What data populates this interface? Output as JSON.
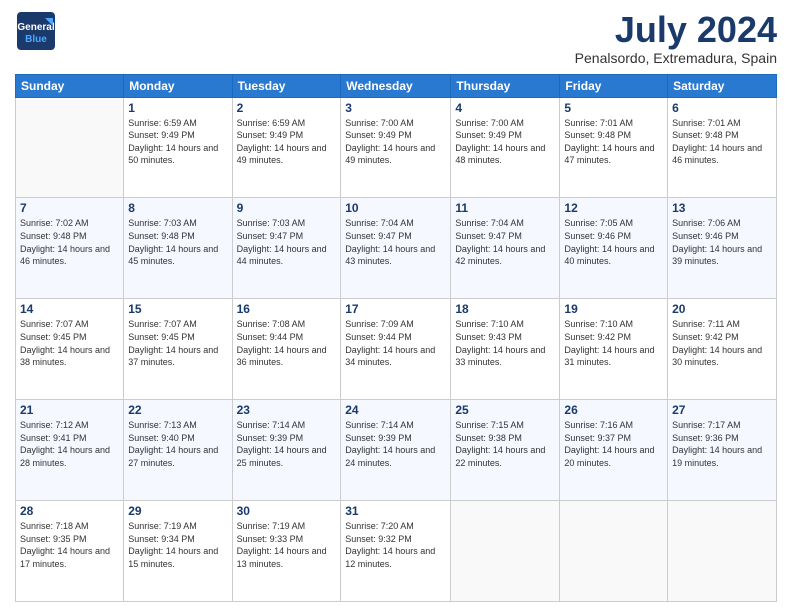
{
  "logo": {
    "line1": "General",
    "line2": "Blue"
  },
  "title": "July 2024",
  "location": "Penalsordo, Extremadura, Spain",
  "weekdays": [
    "Sunday",
    "Monday",
    "Tuesday",
    "Wednesday",
    "Thursday",
    "Friday",
    "Saturday"
  ],
  "weeks": [
    [
      {
        "day": "",
        "sunrise": "",
        "sunset": "",
        "daylight": ""
      },
      {
        "day": "1",
        "sunrise": "Sunrise: 6:59 AM",
        "sunset": "Sunset: 9:49 PM",
        "daylight": "Daylight: 14 hours and 50 minutes."
      },
      {
        "day": "2",
        "sunrise": "Sunrise: 6:59 AM",
        "sunset": "Sunset: 9:49 PM",
        "daylight": "Daylight: 14 hours and 49 minutes."
      },
      {
        "day": "3",
        "sunrise": "Sunrise: 7:00 AM",
        "sunset": "Sunset: 9:49 PM",
        "daylight": "Daylight: 14 hours and 49 minutes."
      },
      {
        "day": "4",
        "sunrise": "Sunrise: 7:00 AM",
        "sunset": "Sunset: 9:49 PM",
        "daylight": "Daylight: 14 hours and 48 minutes."
      },
      {
        "day": "5",
        "sunrise": "Sunrise: 7:01 AM",
        "sunset": "Sunset: 9:48 PM",
        "daylight": "Daylight: 14 hours and 47 minutes."
      },
      {
        "day": "6",
        "sunrise": "Sunrise: 7:01 AM",
        "sunset": "Sunset: 9:48 PM",
        "daylight": "Daylight: 14 hours and 46 minutes."
      }
    ],
    [
      {
        "day": "7",
        "sunrise": "Sunrise: 7:02 AM",
        "sunset": "Sunset: 9:48 PM",
        "daylight": "Daylight: 14 hours and 46 minutes."
      },
      {
        "day": "8",
        "sunrise": "Sunrise: 7:03 AM",
        "sunset": "Sunset: 9:48 PM",
        "daylight": "Daylight: 14 hours and 45 minutes."
      },
      {
        "day": "9",
        "sunrise": "Sunrise: 7:03 AM",
        "sunset": "Sunset: 9:47 PM",
        "daylight": "Daylight: 14 hours and 44 minutes."
      },
      {
        "day": "10",
        "sunrise": "Sunrise: 7:04 AM",
        "sunset": "Sunset: 9:47 PM",
        "daylight": "Daylight: 14 hours and 43 minutes."
      },
      {
        "day": "11",
        "sunrise": "Sunrise: 7:04 AM",
        "sunset": "Sunset: 9:47 PM",
        "daylight": "Daylight: 14 hours and 42 minutes."
      },
      {
        "day": "12",
        "sunrise": "Sunrise: 7:05 AM",
        "sunset": "Sunset: 9:46 PM",
        "daylight": "Daylight: 14 hours and 40 minutes."
      },
      {
        "day": "13",
        "sunrise": "Sunrise: 7:06 AM",
        "sunset": "Sunset: 9:46 PM",
        "daylight": "Daylight: 14 hours and 39 minutes."
      }
    ],
    [
      {
        "day": "14",
        "sunrise": "Sunrise: 7:07 AM",
        "sunset": "Sunset: 9:45 PM",
        "daylight": "Daylight: 14 hours and 38 minutes."
      },
      {
        "day": "15",
        "sunrise": "Sunrise: 7:07 AM",
        "sunset": "Sunset: 9:45 PM",
        "daylight": "Daylight: 14 hours and 37 minutes."
      },
      {
        "day": "16",
        "sunrise": "Sunrise: 7:08 AM",
        "sunset": "Sunset: 9:44 PM",
        "daylight": "Daylight: 14 hours and 36 minutes."
      },
      {
        "day": "17",
        "sunrise": "Sunrise: 7:09 AM",
        "sunset": "Sunset: 9:44 PM",
        "daylight": "Daylight: 14 hours and 34 minutes."
      },
      {
        "day": "18",
        "sunrise": "Sunrise: 7:10 AM",
        "sunset": "Sunset: 9:43 PM",
        "daylight": "Daylight: 14 hours and 33 minutes."
      },
      {
        "day": "19",
        "sunrise": "Sunrise: 7:10 AM",
        "sunset": "Sunset: 9:42 PM",
        "daylight": "Daylight: 14 hours and 31 minutes."
      },
      {
        "day": "20",
        "sunrise": "Sunrise: 7:11 AM",
        "sunset": "Sunset: 9:42 PM",
        "daylight": "Daylight: 14 hours and 30 minutes."
      }
    ],
    [
      {
        "day": "21",
        "sunrise": "Sunrise: 7:12 AM",
        "sunset": "Sunset: 9:41 PM",
        "daylight": "Daylight: 14 hours and 28 minutes."
      },
      {
        "day": "22",
        "sunrise": "Sunrise: 7:13 AM",
        "sunset": "Sunset: 9:40 PM",
        "daylight": "Daylight: 14 hours and 27 minutes."
      },
      {
        "day": "23",
        "sunrise": "Sunrise: 7:14 AM",
        "sunset": "Sunset: 9:39 PM",
        "daylight": "Daylight: 14 hours and 25 minutes."
      },
      {
        "day": "24",
        "sunrise": "Sunrise: 7:14 AM",
        "sunset": "Sunset: 9:39 PM",
        "daylight": "Daylight: 14 hours and 24 minutes."
      },
      {
        "day": "25",
        "sunrise": "Sunrise: 7:15 AM",
        "sunset": "Sunset: 9:38 PM",
        "daylight": "Daylight: 14 hours and 22 minutes."
      },
      {
        "day": "26",
        "sunrise": "Sunrise: 7:16 AM",
        "sunset": "Sunset: 9:37 PM",
        "daylight": "Daylight: 14 hours and 20 minutes."
      },
      {
        "day": "27",
        "sunrise": "Sunrise: 7:17 AM",
        "sunset": "Sunset: 9:36 PM",
        "daylight": "Daylight: 14 hours and 19 minutes."
      }
    ],
    [
      {
        "day": "28",
        "sunrise": "Sunrise: 7:18 AM",
        "sunset": "Sunset: 9:35 PM",
        "daylight": "Daylight: 14 hours and 17 minutes."
      },
      {
        "day": "29",
        "sunrise": "Sunrise: 7:19 AM",
        "sunset": "Sunset: 9:34 PM",
        "daylight": "Daylight: 14 hours and 15 minutes."
      },
      {
        "day": "30",
        "sunrise": "Sunrise: 7:19 AM",
        "sunset": "Sunset: 9:33 PM",
        "daylight": "Daylight: 14 hours and 13 minutes."
      },
      {
        "day": "31",
        "sunrise": "Sunrise: 7:20 AM",
        "sunset": "Sunset: 9:32 PM",
        "daylight": "Daylight: 14 hours and 12 minutes."
      },
      {
        "day": "",
        "sunrise": "",
        "sunset": "",
        "daylight": ""
      },
      {
        "day": "",
        "sunrise": "",
        "sunset": "",
        "daylight": ""
      },
      {
        "day": "",
        "sunrise": "",
        "sunset": "",
        "daylight": ""
      }
    ]
  ]
}
